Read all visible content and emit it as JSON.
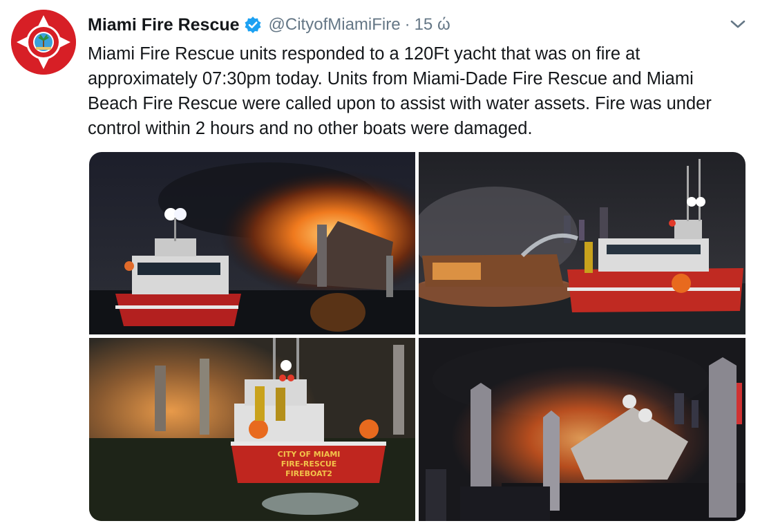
{
  "tweet": {
    "display_name": "Miami Fire Rescue",
    "handle": "@CityofMiamiFire",
    "separator": "·",
    "time": "15 ώ",
    "text": "Miami Fire Rescue units responded to a 120Ft yacht that was on fire at approximately 07:30pm today. Units from Miami-Dade Fire Rescue and Miami Beach Fire Rescue were called upon to assist with water assets. Fire was under control within 2 hours and no other boats were damaged.",
    "verified": true,
    "avatar_seal_text": [
      "CITY OF MIAMI",
      "FIRE RESCUE"
    ],
    "photos": [
      {
        "description_icon": "fireboat-photo-1"
      },
      {
        "description_icon": "fireboat-photo-2"
      },
      {
        "description_icon": "fireboat-photo-3",
        "boat_lettering": [
          "CITY OF MIAMI",
          "FIRE-RESCUE",
          "FIREBOAT2"
        ]
      },
      {
        "description_icon": "fireboat-photo-4"
      }
    ]
  },
  "colors": {
    "name": "#14171a",
    "secondary": "#657786",
    "verified": "#1da1f2",
    "brand_red": "#d71f26"
  }
}
